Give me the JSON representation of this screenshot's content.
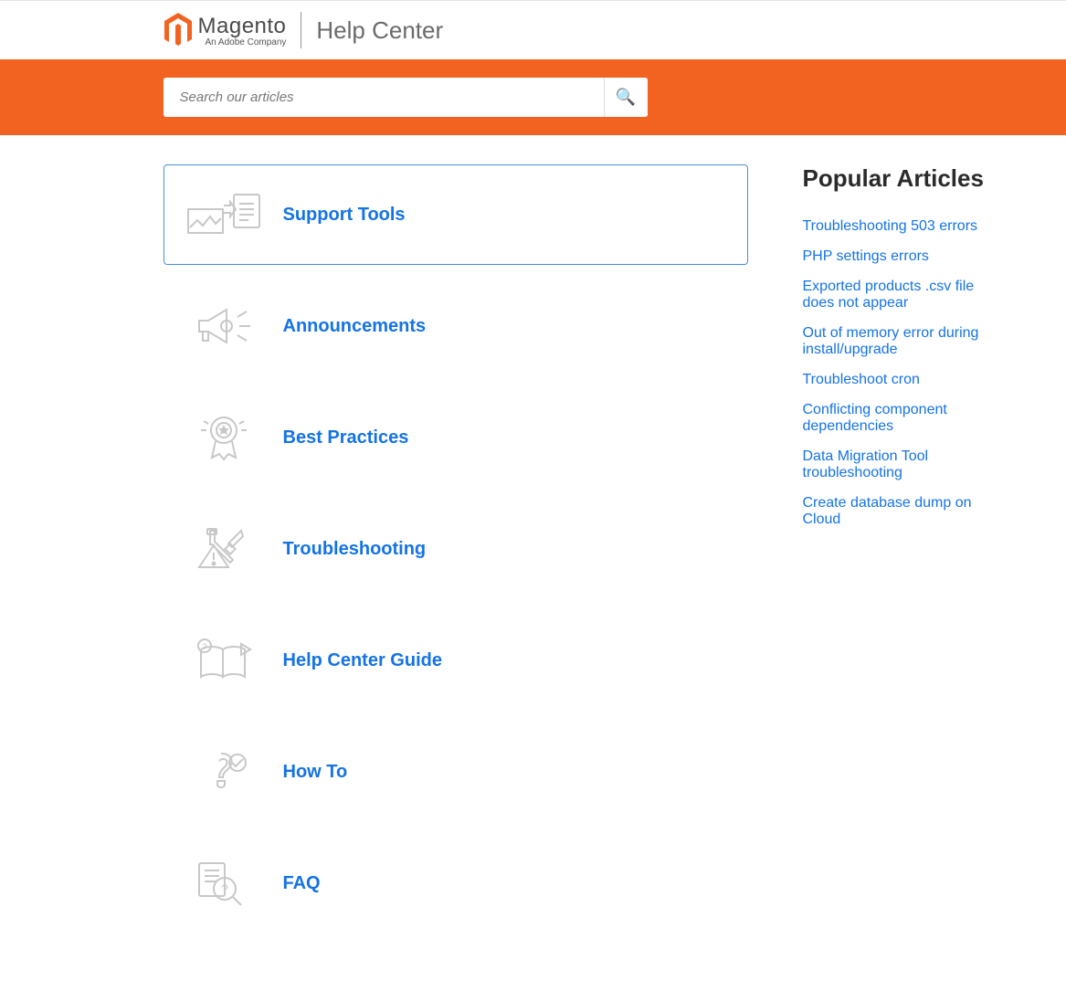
{
  "header": {
    "brand": "Magento",
    "company_tag": "An Adobe Company",
    "help_center_title": "Help Center"
  },
  "search": {
    "placeholder": "Search our articles"
  },
  "categories": [
    {
      "label": "Support Tools",
      "icon": "support-tools",
      "active": true
    },
    {
      "label": "Announcements",
      "icon": "announcements",
      "active": false
    },
    {
      "label": "Best Practices",
      "icon": "best-practices",
      "active": false
    },
    {
      "label": "Troubleshooting",
      "icon": "troubleshooting",
      "active": false
    },
    {
      "label": "Help Center Guide",
      "icon": "help-center-guide",
      "active": false
    },
    {
      "label": "How To",
      "icon": "how-to",
      "active": false
    },
    {
      "label": "FAQ",
      "icon": "faq",
      "active": false
    }
  ],
  "sidebar": {
    "title": "Popular Articles",
    "articles": [
      "Troubleshooting 503 errors",
      "PHP settings errors",
      "Exported products .csv file does not appear",
      "Out of memory error during install/upgrade",
      "Troubleshoot cron",
      "Conflicting component dependencies",
      "Data Migration Tool troubleshooting",
      "Create database dump on Cloud"
    ]
  }
}
